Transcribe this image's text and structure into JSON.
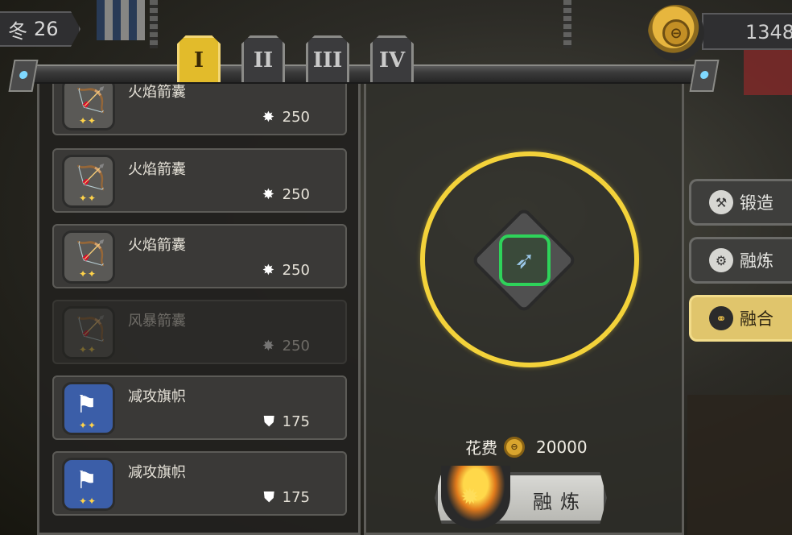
{
  "season": {
    "label": "冬",
    "day": "26"
  },
  "currency": {
    "coin_glyph": "⊖",
    "amount": "1348"
  },
  "tabs": [
    {
      "label": "I",
      "active": true
    },
    {
      "label": "II",
      "active": false
    },
    {
      "label": "III",
      "active": false
    },
    {
      "label": "IV",
      "active": false
    }
  ],
  "items": [
    {
      "name": "火焰箭囊",
      "cost": "250",
      "cost_icon": "✸",
      "icon": "flame-quiver-icon",
      "glyph": "🏹",
      "stars": "✦✦",
      "dimmed": false
    },
    {
      "name": "火焰箭囊",
      "cost": "250",
      "cost_icon": "✸",
      "icon": "flame-quiver-icon",
      "glyph": "🏹",
      "stars": "✦✦",
      "dimmed": false
    },
    {
      "name": "火焰箭囊",
      "cost": "250",
      "cost_icon": "✸",
      "icon": "flame-quiver-icon",
      "glyph": "🏹",
      "stars": "✦✦",
      "dimmed": false
    },
    {
      "name": "风暴箭囊",
      "cost": "250",
      "cost_icon": "✸",
      "icon": "storm-quiver-icon",
      "glyph": "🏹",
      "stars": "✦✦",
      "dimmed": true
    },
    {
      "name": "减攻旗帜",
      "cost": "175",
      "cost_icon": "⛊",
      "icon": "banner-icon",
      "glyph": "⚑",
      "stars": "✦✦",
      "dimmed": false
    },
    {
      "name": "减攻旗帜",
      "cost": "175",
      "cost_icon": "⛊",
      "icon": "banner-icon",
      "glyph": "⚑",
      "stars": "✦✦",
      "dimmed": false
    }
  ],
  "fusion": {
    "slot_item_glyph": "➶",
    "cost_label": "花费",
    "cost_coin_glyph": "⊖",
    "cost_value": "20000",
    "button_label": "融炼",
    "pot_glyph": "✹"
  },
  "side_menu": [
    {
      "label": "锻造",
      "icon": "anvil-icon",
      "glyph": "⚒",
      "active": false
    },
    {
      "label": "融炼",
      "icon": "cauldron-icon",
      "glyph": "⚙",
      "active": false
    },
    {
      "label": "融合",
      "icon": "merge-icon",
      "glyph": "⚭",
      "active": true
    }
  ],
  "colors": {
    "active_tab": "#e2bb2b",
    "slot_ring": "#f3d23a",
    "slot_item_border": "#2ed35a",
    "active_side_button": "#e0c56c"
  }
}
